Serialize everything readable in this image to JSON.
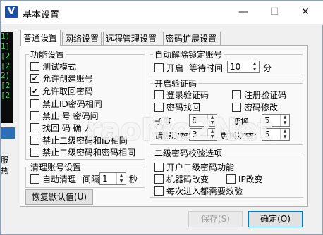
{
  "window": {
    "title": "基本设置",
    "icon_letter": "V",
    "controls": {
      "minimize": "—",
      "maximize": "☐",
      "close": "✕"
    }
  },
  "background": {
    "console_lines": [
      "1)",
      "1]",
      "[2",
      "[2",
      "2)",
      "[2",
      "[2"
    ],
    "side_labels": [
      "服",
      "热"
    ]
  },
  "tabs": [
    "普通设置",
    "网络设置",
    "远程管理设置",
    "密码扩展设置"
  ],
  "active_tab": 0,
  "function_settings": {
    "title": "功能设置",
    "items": [
      {
        "label": "测试模式",
        "checked": false
      },
      {
        "label": "允许创建账号",
        "checked": true
      },
      {
        "label": "允许取回密码",
        "checked": true
      },
      {
        "label": "禁止ID密码相同",
        "checked": false
      },
      {
        "label": "禁止 号 密码问",
        "checked": false
      },
      {
        "label": "找回 码 确 人",
        "checked": false
      },
      {
        "label": "禁止二级密码和ID相同",
        "checked": false
      },
      {
        "label": "禁止二级密码和密码相同",
        "checked": false
      }
    ]
  },
  "clear_accounts": {
    "title": "清理账号设置",
    "auto_clear_label": "自动清理",
    "auto_clear_checked": false,
    "interval_label": "间隔",
    "interval_value": "1",
    "seconds_label": "秒",
    "restore_default_label": "恢复默认值(U)"
  },
  "auto_unlock": {
    "title": "自动解除锁定账号",
    "enable_label": "开启",
    "enable_checked": false,
    "wait_label": "等待时间",
    "wait_value": "10",
    "minutes_label": "分"
  },
  "verification_code": {
    "title": "开启验证码",
    "items": [
      {
        "label": "登录验证码",
        "checked": false
      },
      {
        "label": "注册验证码",
        "checked": false
      },
      {
        "label": "密码找回",
        "checked": false
      },
      {
        "label": "密码修改",
        "checked": false
      }
    ],
    "length_label": "长度",
    "length_value": "8",
    "length2_label": "变换",
    "length2_value": "5",
    "error_label": "错误次数:",
    "error_value": "3",
    "change_label": "更换次数:",
    "change_value": "5"
  },
  "second_password": {
    "title": "二级密码校验选项",
    "items": [
      {
        "label": "开户二级密码功能",
        "checked": false
      },
      {
        "label": "机器码改变",
        "checked": false
      },
      {
        "label": "IP改变",
        "checked": false
      },
      {
        "label": "每次进入都需要效验",
        "checked": false
      }
    ]
  },
  "buttons": {
    "save": "保存(S)",
    "ok": "确定(O)"
  },
  "watermark": "raoMe2Net"
}
